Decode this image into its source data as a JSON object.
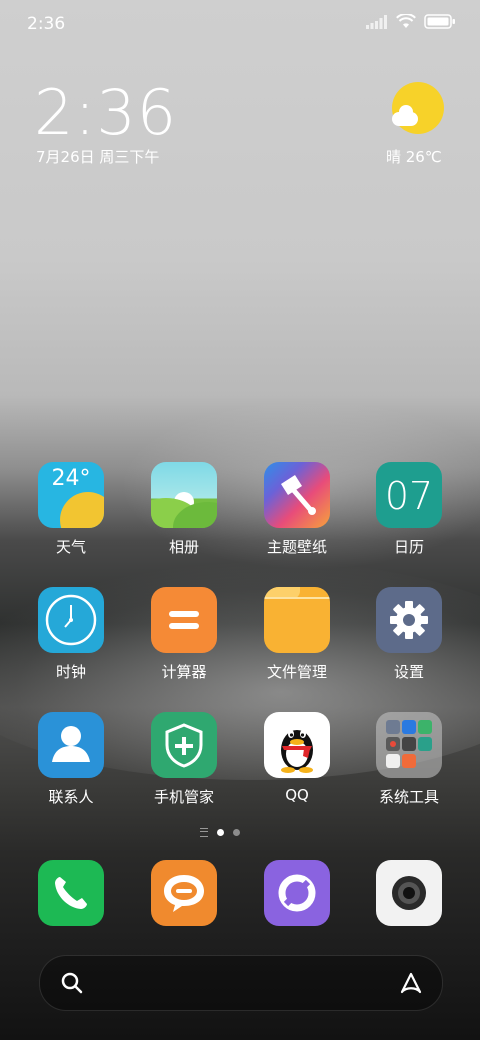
{
  "statusbar": {
    "time": "2:36"
  },
  "lockclock": {
    "time": "2:36",
    "date": "7月26日 周三下午",
    "weather": "晴 26℃"
  },
  "apps": [
    {
      "label": "天气",
      "icon": "weather-app-icon",
      "text": "24°"
    },
    {
      "label": "相册",
      "icon": "gallery-app-icon"
    },
    {
      "label": "主题壁纸",
      "icon": "themes-app-icon"
    },
    {
      "label": "日历",
      "icon": "calendar-app-icon",
      "text": "07"
    },
    {
      "label": "时钟",
      "icon": "clock-app-icon"
    },
    {
      "label": "计算器",
      "icon": "calculator-app-icon"
    },
    {
      "label": "文件管理",
      "icon": "files-app-icon"
    },
    {
      "label": "设置",
      "icon": "settings-app-icon"
    },
    {
      "label": "联系人",
      "icon": "contacts-app-icon"
    },
    {
      "label": "手机管家",
      "icon": "security-app-icon"
    },
    {
      "label": "QQ",
      "icon": "qq-app-icon"
    },
    {
      "label": "系统工具",
      "icon": "system-tools-folder-icon"
    }
  ],
  "page_indicator": {
    "pages": 2,
    "current": 1
  },
  "dock": [
    {
      "icon": "phone-app-icon",
      "color": "#1db954"
    },
    {
      "icon": "messages-app-icon",
      "color": "#f08a2e"
    },
    {
      "icon": "browser-app-icon",
      "color": "#8a63e0"
    },
    {
      "icon": "camera-app-icon",
      "color": "#f2f2f2"
    }
  ]
}
